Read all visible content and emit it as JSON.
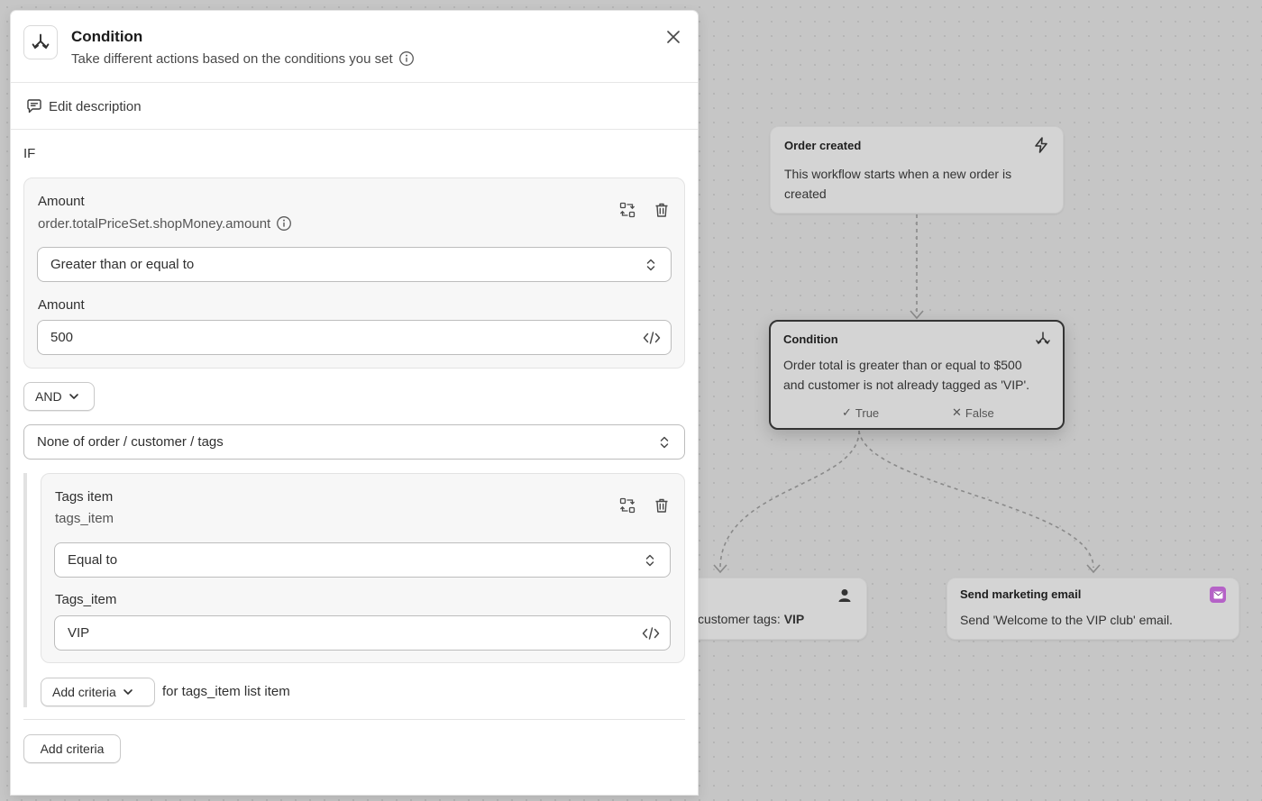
{
  "panel": {
    "title": "Condition",
    "subtitle": "Take different actions based on the conditions you set",
    "edit_description": "Edit description",
    "if_label": "IF",
    "condition1": {
      "title": "Amount",
      "path": "order.totalPriceSet.shopMoney.amount",
      "operator": "Greater than or equal to",
      "value_label": "Amount",
      "value": "500"
    },
    "logic_operator": "AND",
    "list_quantifier": "None of order / customer / tags",
    "condition2": {
      "title": "Tags item",
      "path": "tags_item",
      "operator": "Equal to",
      "value_label": "Tags_item",
      "value": "VIP"
    },
    "add_criteria_inner": "Add criteria",
    "for_list_item": "for tags_item list item",
    "add_criteria_outer": "Add criteria"
  },
  "workflow": {
    "trigger": {
      "title": "Order created",
      "text_line1": "This workflow starts when a new order is",
      "text_line2": "created",
      "icon": "lightning-icon"
    },
    "condition": {
      "title": "Condition",
      "text_line1": "Order total is greater than or equal to $500",
      "text_line2": "and customer is not already tagged as 'VIP'.",
      "true_label": "True",
      "false_label": "False",
      "icon": "branch-icon"
    },
    "action_tags": {
      "text_prefix": "customer tags: ",
      "text_bold": "VIP",
      "icon": "person-icon"
    },
    "action_email": {
      "title": "Send marketing email",
      "text": "Send 'Welcome to the VIP club' email.",
      "icon": "email-icon",
      "icon_color": "#b562c7"
    }
  },
  "colors": {
    "canvas": "#c6c6c6",
    "panel": "#ffffff",
    "card": "#f7f7f7"
  }
}
